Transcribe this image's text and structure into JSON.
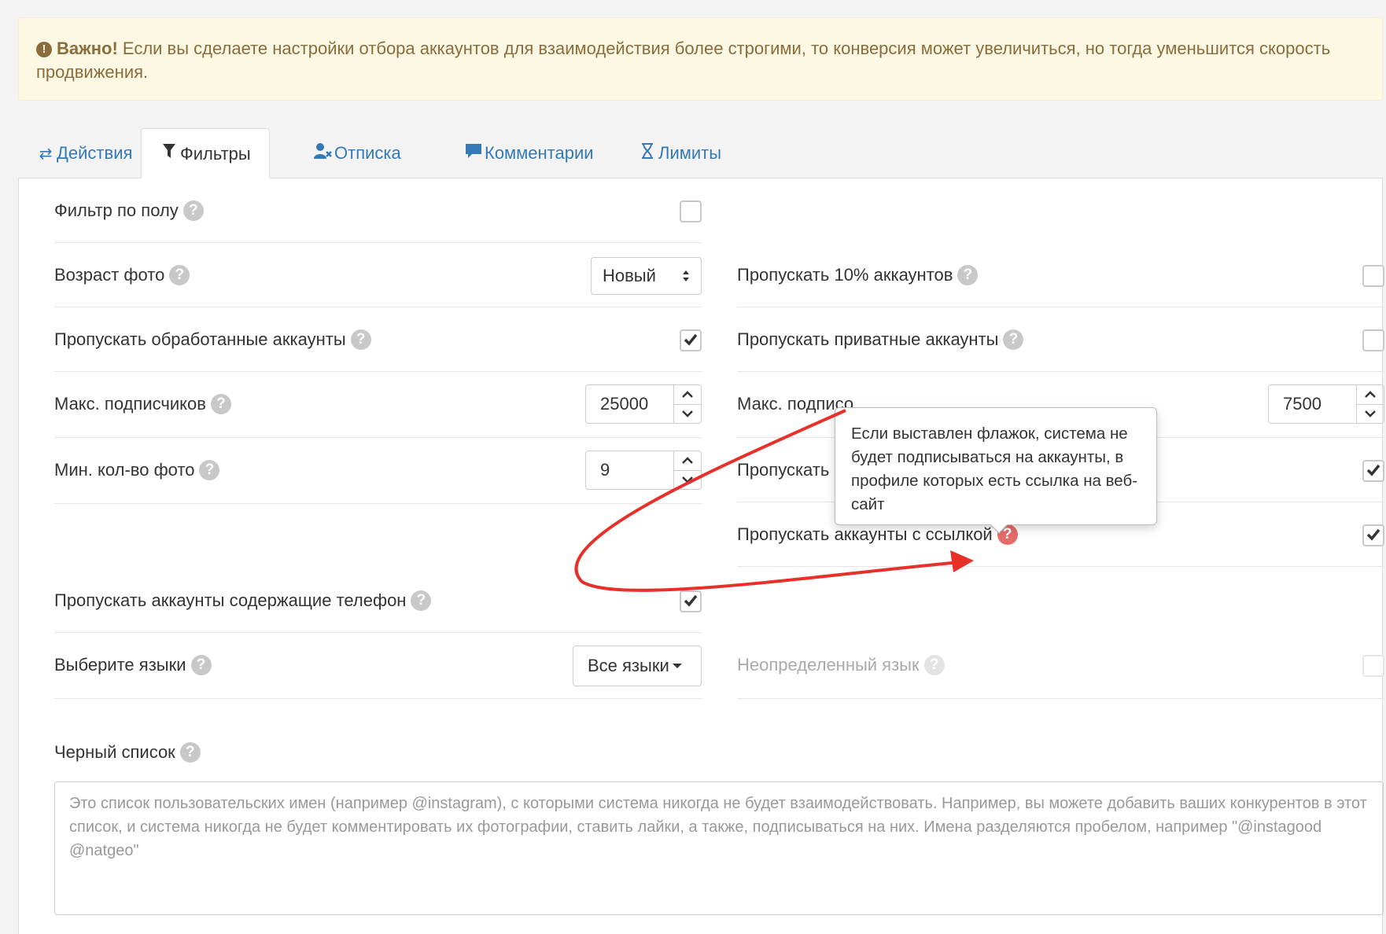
{
  "alert": {
    "strong": "Важно!",
    "text": " Если вы сделаете настройки отбора аккаунтов для взаимодействия более строгими, то конверсия может увеличиться, но тогда уменьшится скорость продвижения."
  },
  "tabs": [
    {
      "label": "Действия",
      "icon": "exchange-icon",
      "active": false
    },
    {
      "label": "Фильтры",
      "icon": "filter-icon",
      "active": true
    },
    {
      "label": "Отписка",
      "icon": "user-remove-icon",
      "active": false
    },
    {
      "label": "Комментарии",
      "icon": "comment-icon",
      "active": false
    },
    {
      "label": "Лимиты",
      "icon": "hourglass-icon",
      "active": false
    }
  ],
  "help_glyph": "?",
  "filters": {
    "gender": {
      "label": "Фильтр по полу",
      "checked": false
    },
    "photo_age": {
      "label": "Возраст фото",
      "value": "Новый"
    },
    "skip_10": {
      "label": "Пропускать 10% аккаунтов",
      "checked": false
    },
    "skip_processed": {
      "label": "Пропускать обработанные аккаунты",
      "checked": true
    },
    "skip_private": {
      "label": "Пропускать приватные аккаунты",
      "checked": false
    },
    "max_followers": {
      "label": "Макс. подписчиков",
      "value": "25000"
    },
    "max_following": {
      "label": "Макс. подписо",
      "value": "7500"
    },
    "min_photos": {
      "label": "Мин. кол-во фото",
      "value": "9"
    },
    "skip_business": {
      "label": "Пропускать би",
      "checked": true
    },
    "skip_link": {
      "label": "Пропускать аккаунты с ссылкой",
      "checked": true
    },
    "skip_phone": {
      "label": "Пропускать аккаунты содержащие телефон",
      "checked": true
    },
    "languages": {
      "label": "Выберите языки",
      "value": "Все языки"
    },
    "undefined_lang": {
      "label": "Неопределенный язык",
      "checked": false,
      "disabled": true
    }
  },
  "blacklist": {
    "label": "Черный список",
    "placeholder": "Это список пользовательских имен (например @instagram), с которыми система никогда не будет взаимодействовать. Например, вы можете добавить ваших конкурентов в этот список, и система никогда не будет комментировать их фотографии, ставить лайки, а также, подписываться на них. Имена разделяются пробелом, например \"@instagood @natgeo\""
  },
  "tooltip": {
    "text": "Если выставлен флажок, система не будет подписываться на аккаунты, в профиле которых есть ссылка на веб-сайт"
  },
  "colors": {
    "link": "#337ab7",
    "alert_bg": "#fcf8e3",
    "alert_text": "#8a6d3b",
    "annotation_arrow": "#e8302a",
    "help_active": "#e56a6a"
  }
}
